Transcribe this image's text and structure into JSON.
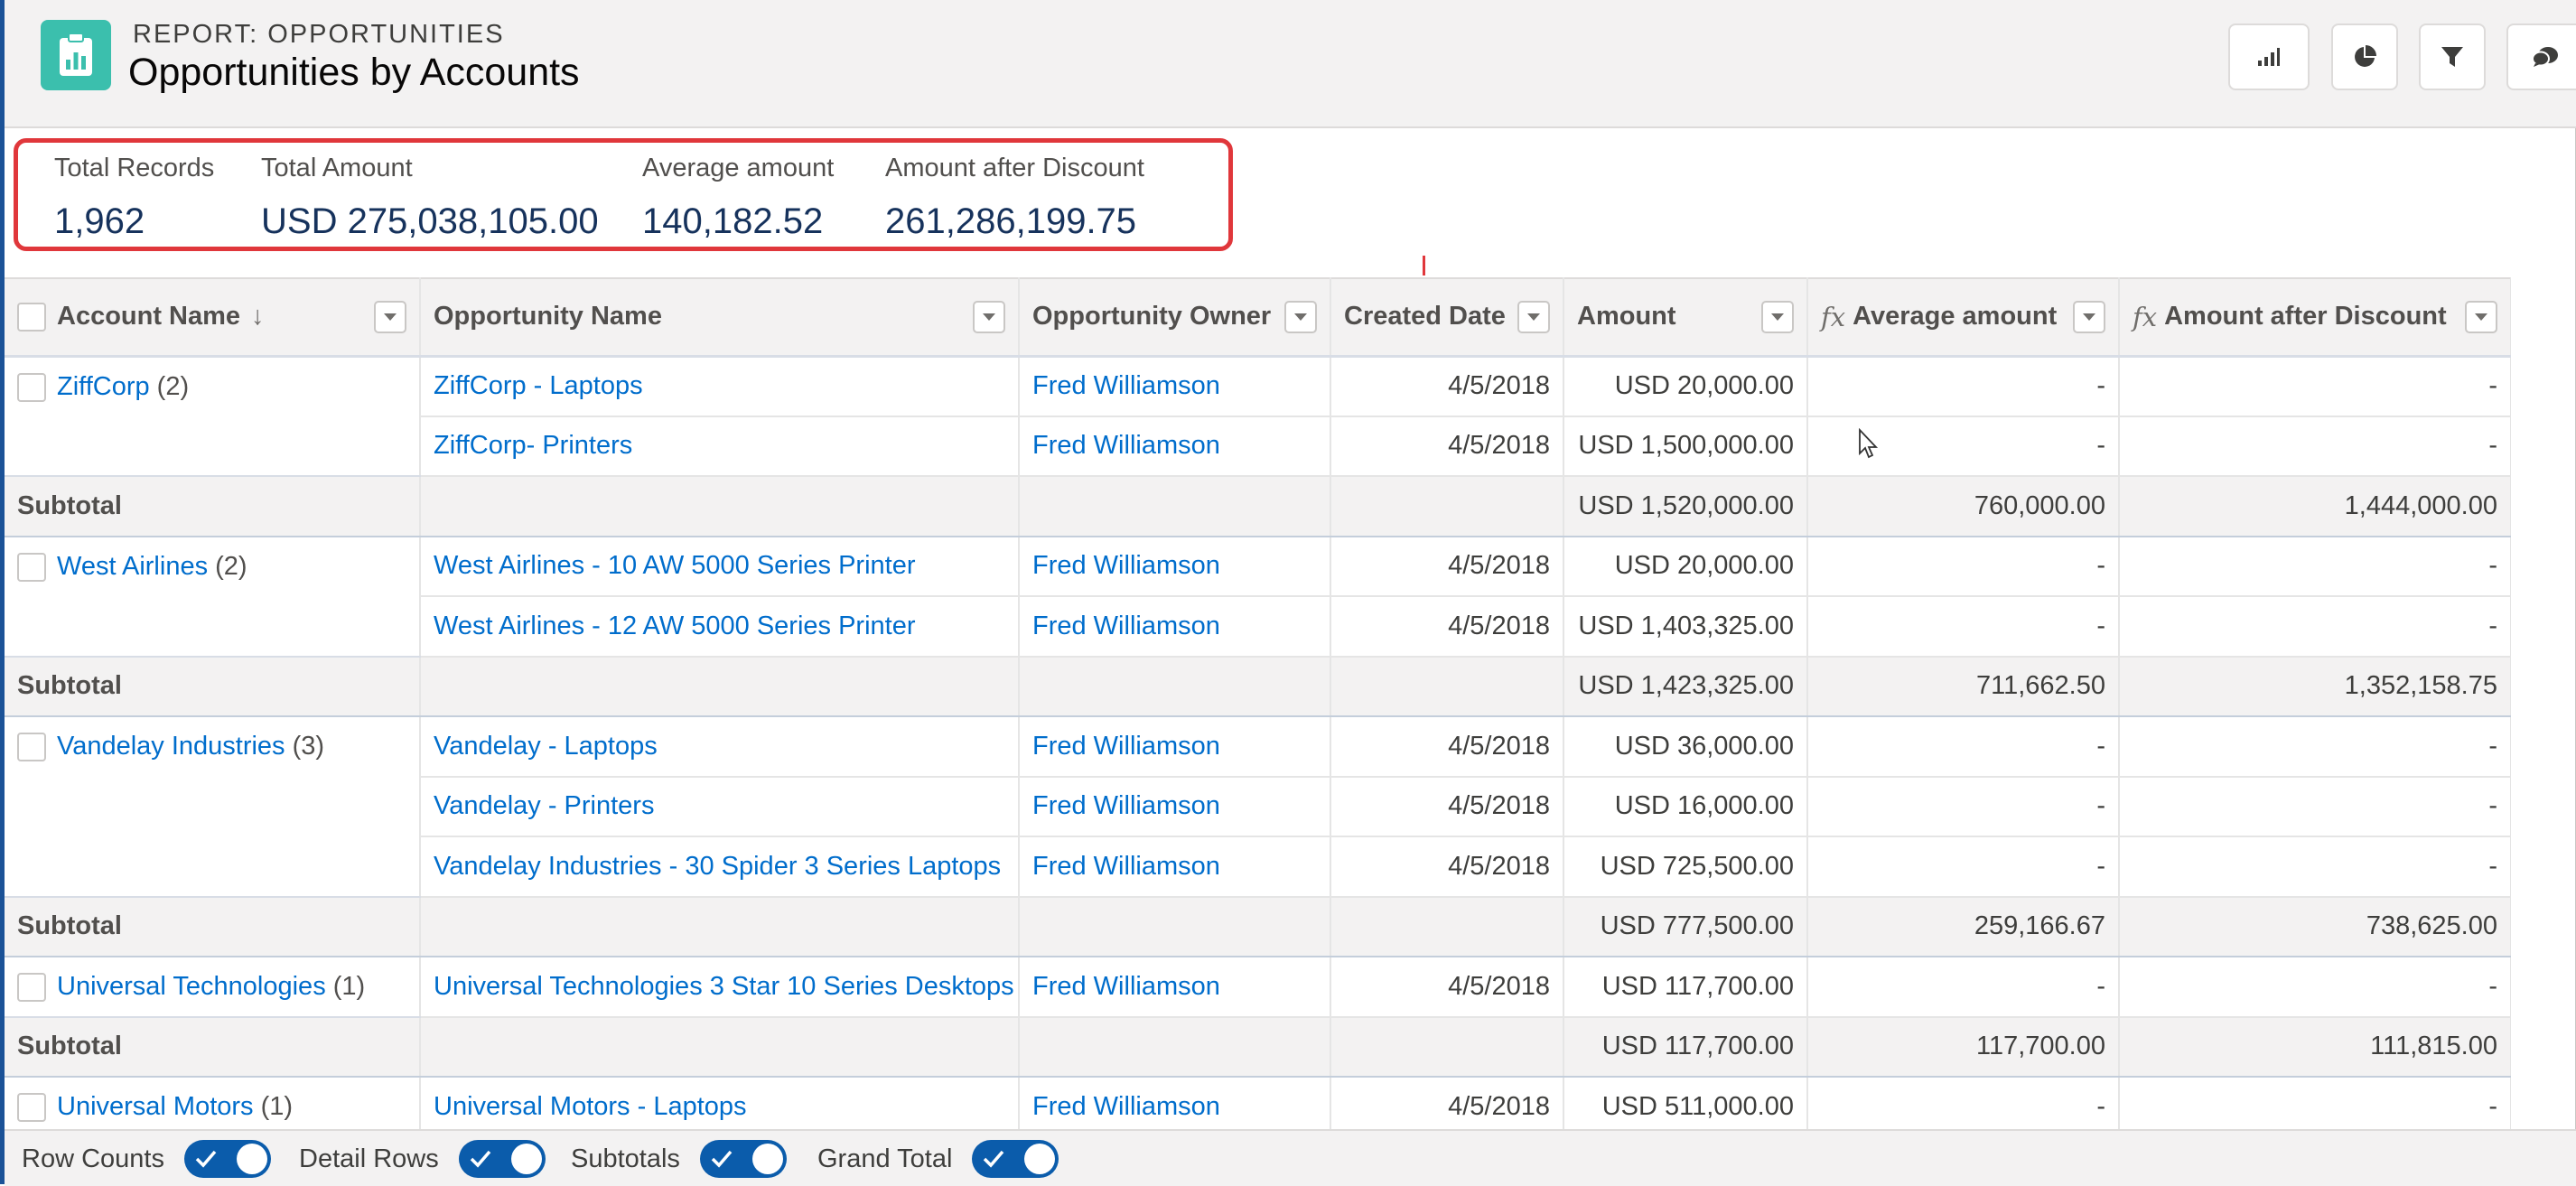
{
  "header": {
    "eyebrow": "REPORT: OPPORTUNITIES",
    "title": "Opportunities by Accounts",
    "icon": "report-icon",
    "actions": [
      {
        "name": "chart-icon"
      },
      {
        "name": "pie-chart-icon"
      },
      {
        "name": "filter-icon"
      },
      {
        "name": "comments-icon"
      }
    ]
  },
  "summary": {
    "total_records_label": "Total Records",
    "total_records_value": "1,962",
    "total_amount_label": "Total Amount",
    "total_amount_value": "USD 275,038,105.00",
    "average_amount_label": "Average amount",
    "average_amount_value": "140,182.52",
    "amount_after_discount_label": "Amount after Discount",
    "amount_after_discount_value": "261,286,199.75"
  },
  "table": {
    "columns": {
      "account": "Account Name",
      "opportunity": "Opportunity Name",
      "owner": "Opportunity Owner",
      "created": "Created Date",
      "amount": "Amount",
      "average": "Average amount",
      "after_discount": "Amount after Discount"
    },
    "subtotal_label": "Subtotal",
    "groups": [
      {
        "account": "ZiffCorp",
        "count": "(2)",
        "rows": [
          {
            "opportunity": "ZiffCorp - Laptops",
            "owner": "Fred Williamson",
            "created": "4/5/2018",
            "amount": "USD 20,000.00",
            "average": "-",
            "after_discount": "-"
          },
          {
            "opportunity": "ZiffCorp- Printers",
            "owner": "Fred Williamson",
            "created": "4/5/2018",
            "amount": "USD 1,500,000.00",
            "average": "-",
            "after_discount": "-"
          }
        ],
        "subtotal": {
          "amount": "USD 1,520,000.00",
          "average": "760,000.00",
          "after_discount": "1,444,000.00"
        }
      },
      {
        "account": "West Airlines",
        "count": "(2)",
        "rows": [
          {
            "opportunity": "West Airlines - 10 AW 5000 Series Printer",
            "owner": "Fred Williamson",
            "created": "4/5/2018",
            "amount": "USD 20,000.00",
            "average": "-",
            "after_discount": "-"
          },
          {
            "opportunity": "West Airlines - 12 AW 5000 Series Printer",
            "owner": "Fred Williamson",
            "created": "4/5/2018",
            "amount": "USD 1,403,325.00",
            "average": "-",
            "after_discount": "-"
          }
        ],
        "subtotal": {
          "amount": "USD 1,423,325.00",
          "average": "711,662.50",
          "after_discount": "1,352,158.75"
        }
      },
      {
        "account": "Vandelay Industries",
        "count": "(3)",
        "rows": [
          {
            "opportunity": "Vandelay - Laptops",
            "owner": "Fred Williamson",
            "created": "4/5/2018",
            "amount": "USD 36,000.00",
            "average": "-",
            "after_discount": "-"
          },
          {
            "opportunity": "Vandelay - Printers",
            "owner": "Fred Williamson",
            "created": "4/5/2018",
            "amount": "USD 16,000.00",
            "average": "-",
            "after_discount": "-"
          },
          {
            "opportunity": "Vandelay Industries - 30 Spider 3 Series Laptops",
            "owner": "Fred Williamson",
            "created": "4/5/2018",
            "amount": "USD 725,500.00",
            "average": "-",
            "after_discount": "-"
          }
        ],
        "subtotal": {
          "amount": "USD 777,500.00",
          "average": "259,166.67",
          "after_discount": "738,625.00"
        }
      },
      {
        "account": "Universal Technologies",
        "count": "(1)",
        "rows": [
          {
            "opportunity": "Universal Technologies 3 Star 10 Series Desktops",
            "owner": "Fred Williamson",
            "created": "4/5/2018",
            "amount": "USD 117,700.00",
            "average": "-",
            "after_discount": "-"
          }
        ],
        "subtotal": {
          "amount": "USD 117,700.00",
          "average": "117,700.00",
          "after_discount": "111,815.00"
        }
      },
      {
        "account": "Universal Motors",
        "count": "(1)",
        "rows": [
          {
            "opportunity": "Universal Motors - Laptops",
            "owner": "Fred Williamson",
            "created": "4/5/2018",
            "amount": "USD 511,000.00",
            "average": "-",
            "after_discount": "-"
          }
        ]
      }
    ]
  },
  "footer": {
    "toggles": [
      {
        "label": "Row Counts",
        "on": true
      },
      {
        "label": "Detail Rows",
        "on": true
      },
      {
        "label": "Subtotals",
        "on": true
      },
      {
        "label": "Grand Total",
        "on": true
      }
    ]
  },
  "colors": {
    "link": "#006dcc",
    "app_icon": "#3bbfad",
    "highlight_border": "#e0373b",
    "toggle_on": "#0b5cab",
    "metric_value": "#16325c"
  }
}
